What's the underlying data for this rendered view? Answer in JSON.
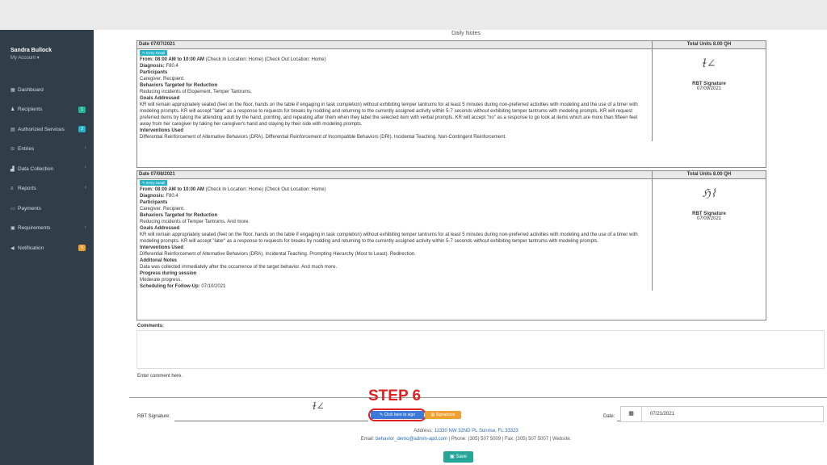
{
  "sidebar": {
    "user_name": "Sandra Bullock",
    "account_label": "My Account ▾",
    "items": [
      {
        "label": "Dashboard",
        "icon": "dashboard-icon",
        "glyph": "▦",
        "badge": "",
        "badge_color": "",
        "chevron": ""
      },
      {
        "label": "Recipients",
        "icon": "recipients-icon",
        "glyph": "♟",
        "badge": "1",
        "badge_color": "#26b59a",
        "chevron": ""
      },
      {
        "label": "Authorized Services",
        "icon": "authorized-services-icon",
        "glyph": "▤",
        "badge": "2",
        "badge_color": "#26b3c9",
        "chevron": ""
      },
      {
        "label": "Entries",
        "icon": "entries-icon",
        "glyph": "⊙",
        "badge": "",
        "badge_color": "",
        "chevron": "‹"
      },
      {
        "label": "Data Collection",
        "icon": "data-collection-icon",
        "glyph": "▟",
        "badge": "",
        "badge_color": "",
        "chevron": "‹"
      },
      {
        "label": "Reports",
        "icon": "reports-icon",
        "glyph": "≡",
        "badge": "",
        "badge_color": "",
        "chevron": "‹"
      },
      {
        "label": "Payments",
        "icon": "payments-icon",
        "glyph": "▭",
        "badge": "",
        "badge_color": "",
        "chevron": ""
      },
      {
        "label": "Requirements",
        "icon": "requirements-icon",
        "glyph": "▣",
        "badge": "",
        "badge_color": "",
        "chevron": "‹"
      },
      {
        "label": "Notification",
        "icon": "notification-icon",
        "glyph": "◀",
        "badge": "0",
        "badge_color": "#f0a030",
        "chevron": ""
      }
    ]
  },
  "page": {
    "title": "Daily Notes"
  },
  "entries": [
    {
      "date": "Date 07/07/2021",
      "units": "Total Units 8.00 QH",
      "entry_btn": "Entry Detail",
      "lines": [
        {
          "bold": "From: 08:00 AM to 10:00 AM",
          "text": " (Check In Location: Home) (Check Out Location: Home)"
        },
        {
          "bold": "Diagnosis:",
          "text": " F80.4"
        },
        {
          "bold": "Participants",
          "text": ""
        },
        {
          "bold": "",
          "text": "Caregiver. Recipient."
        },
        {
          "bold": "Behaviors Targeted for Reduction",
          "text": ""
        },
        {
          "bold": "",
          "text": "Reducing incidents of Elopement, Temper Tantrums,"
        },
        {
          "bold": "Goals Addressed",
          "text": ""
        },
        {
          "bold": "",
          "text": "KR will remain appropriately seated (feet on the floor, hands on the table if engaging in task completion) without exhibiting temper tantrums for at least 5 minutes during non-preferred activities with modeling and the use of a timer with modeling prompts. KR will accept \"later\" as a response to requests for breaks by nodding and returning to the currently assigned activity within 5-7 seconds without exhibiting temper tantrums with modeling prompts. KR will request preferred items by taking the attending adult by the hand, pointing, and repeating after them when they label the selected item with verbal prompts. KR will accept \"no\" as a response to go look at items which are more than fifteen feet away from her caregiver by taking her caregiver's hand and staying by their side with modeling prompts."
        },
        {
          "bold": "Interventions Used",
          "text": ""
        },
        {
          "bold": "",
          "text": "Differential Reinforcement of Alternative Behaviors (DRA). Differential Reinforcement of Incompatible Behaviors (DRI). Incidental Teaching. Non-Contingent Reinforcement."
        }
      ],
      "sig_label": "RBT Signature",
      "sig_date": "07/09/2021"
    },
    {
      "date": "Date 07/08/2021",
      "units": "Total Units 8.00 QH",
      "entry_btn": "Entry Detail",
      "lines": [
        {
          "bold": "From: 08:00 AM to 10:00 AM",
          "text": " (Check In Location: Home) (Check Out Location: Home)"
        },
        {
          "bold": "Diagnosis:",
          "text": " F80.4"
        },
        {
          "bold": "Participants",
          "text": ""
        },
        {
          "bold": "",
          "text": "Caregiver. Recipient."
        },
        {
          "bold": "Behaviors Targeted for Reduction",
          "text": ""
        },
        {
          "bold": "",
          "text": "Reducing incidents of Temper Tantrums. And more."
        },
        {
          "bold": "Goals Addressed",
          "text": ""
        },
        {
          "bold": "",
          "text": "KR will remain appropriately seated (feet on the floor, hands on the table if engaging in task completion) without exhibiting temper tantrums for at least 5 minutes during non-preferred activities with modeling and the use of a timer with modeling prompts. KR will accept \"later\" as a response to requests for breaks by nodding and returning to the currently assigned activity within 5-7 seconds without exhibiting temper tantrums with modeling prompts."
        },
        {
          "bold": "Interventions Used",
          "text": ""
        },
        {
          "bold": "",
          "text": "Differential Reinforcement of Alternative Behaviors (DRA). Incidental Teaching. Prompting Hierarchy (Most to Least). Redirection."
        },
        {
          "bold": "Additonal Notes",
          "text": ""
        },
        {
          "bold": "",
          "text": "Data was collected immediately after the occurrence of the target behavior. And much more."
        },
        {
          "bold": "Progress during session",
          "text": ""
        },
        {
          "bold": "",
          "text": "Moderate progress."
        },
        {
          "bold": "Scheduling for Follow-Up:",
          "text": " 07/10/2021"
        }
      ],
      "sig_label": "RBT Signature",
      "sig_date": "07/09/2021"
    }
  ],
  "comments": {
    "label": "Comments:",
    "hint": "Enter comment here."
  },
  "footer": {
    "rbt_label": "RBT Signature:",
    "step_label": "STEP 6",
    "sign_btn": "Click here to sign",
    "signatures_btn": "Signatures",
    "date_label": "Date:",
    "date_value": "07/21/2021",
    "address_label": "Address:",
    "address": "11330 NW 32ND PL Sunrise, FL 33323",
    "email_label": "Email:",
    "email": "behavior_demo@admin-apd.com",
    "phone_text": " | Phone: (305) 507 5009 | Fax: (305) 507 5007 | Website:",
    "save_btn": "Save"
  },
  "colors": {
    "sidebar": "#2f3e48",
    "accent": "#26a69a",
    "step": "#e02020",
    "sign": "#3b7ad8"
  }
}
